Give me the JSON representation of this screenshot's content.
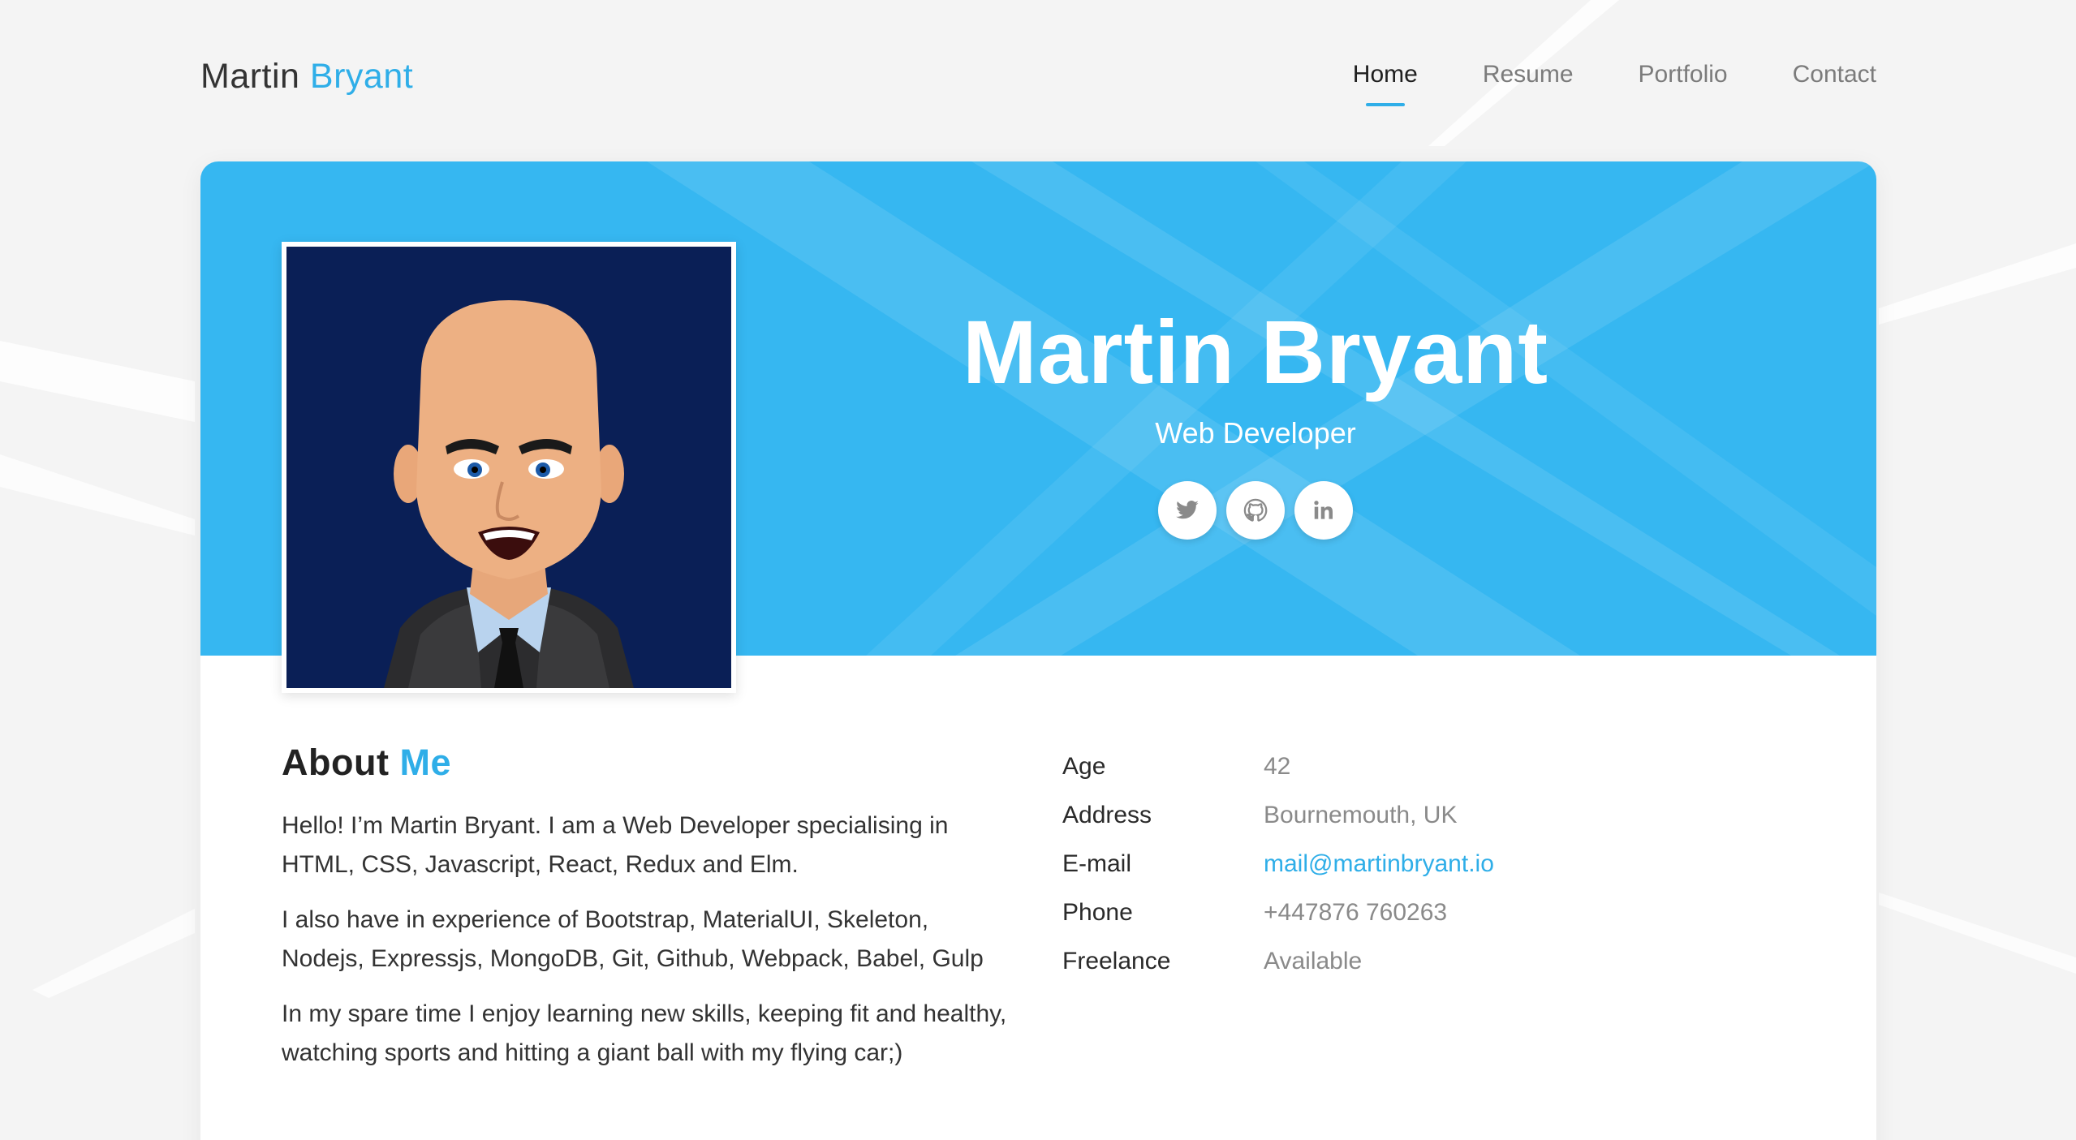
{
  "header": {
    "brand_first": "Martin",
    "brand_second": "Bryant",
    "nav": [
      {
        "label": "Home",
        "active": true
      },
      {
        "label": "Resume",
        "active": false
      },
      {
        "label": "Portfolio",
        "active": false
      },
      {
        "label": "Contact",
        "active": false
      }
    ]
  },
  "hero": {
    "name": "Martin Bryant",
    "role": "Web Developer",
    "socials": [
      "twitter-icon",
      "github-icon",
      "linkedin-icon"
    ]
  },
  "about": {
    "title_first": "About",
    "title_second": "Me",
    "paragraphs": [
      "Hello! I’m Martin Bryant. I am a Web Developer specialising in HTML, CSS, Javascript, React, Redux and Elm.",
      "I also have in experience of Bootstrap, MaterialUI, Skeleton, Nodejs, Expressjs, MongoDB, Git, Github, Webpack, Babel, Gulp",
      "In my spare time I enjoy learning new skills, keeping fit and healthy, watching sports and hitting a giant ball with my flying car;)"
    ]
  },
  "info": [
    {
      "label": "Age",
      "value": "42"
    },
    {
      "label": "Address",
      "value": "Bournemouth, UK"
    },
    {
      "label": "E-mail",
      "value": "mail@martinbryant.io"
    },
    {
      "label": "Phone",
      "value": "+447876 760263"
    },
    {
      "label": "Freelance",
      "value": "Available"
    }
  ],
  "colors": {
    "accent": "#2faee8",
    "banner": "#36b7f1",
    "avatar_background": "#0a1f56"
  }
}
